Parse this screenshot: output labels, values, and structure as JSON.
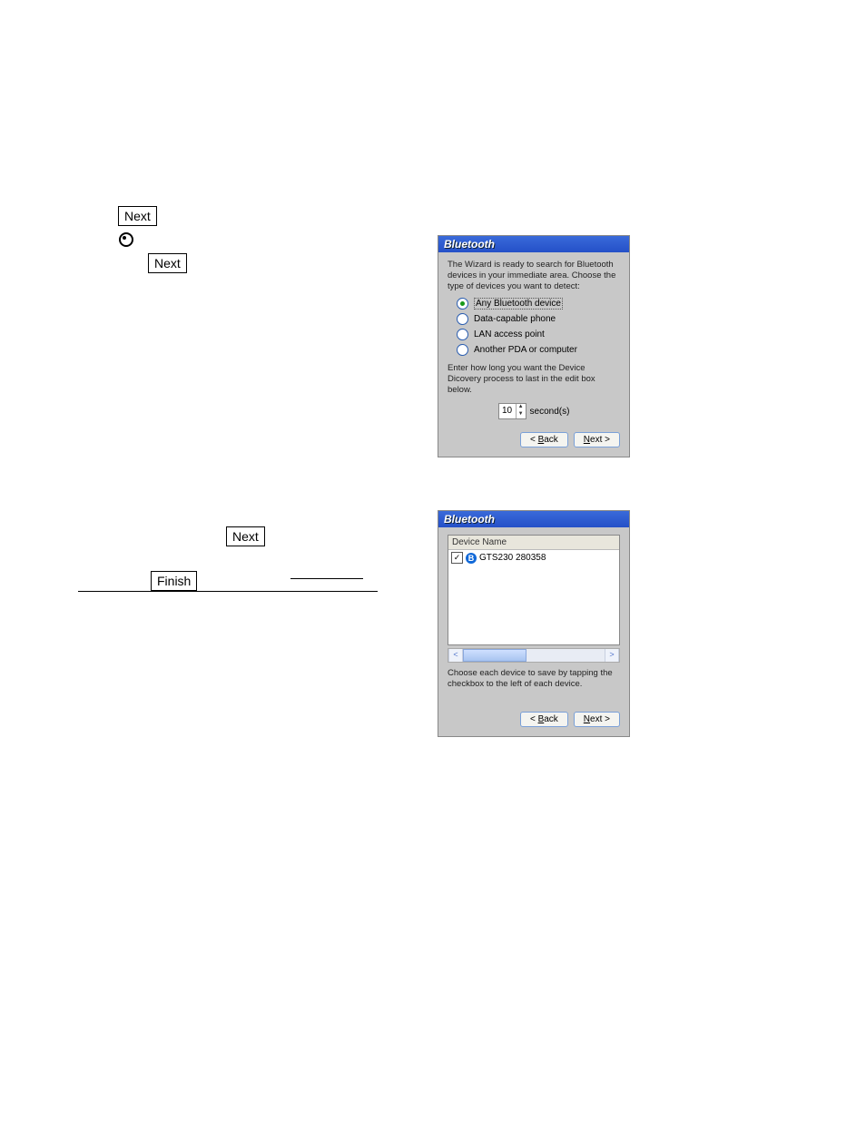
{
  "buttons": {
    "next": "Next",
    "finish": "Finish"
  },
  "panel1": {
    "title": "Bluetooth",
    "intro": "The Wizard is ready to search for Bluetooth devices in your immediate area. Choose the type of devices you want to detect:",
    "options": [
      {
        "label": "Any Bluetooth device",
        "selected": true
      },
      {
        "label": "Data-capable phone",
        "selected": false
      },
      {
        "label": "LAN access point",
        "selected": false
      },
      {
        "label": "Another PDA or computer",
        "selected": false
      }
    ],
    "duration_text": "Enter how long you want the Device Dicovery process to last in the edit box below.",
    "duration_value": "10",
    "duration_unit": "second(s)",
    "back": "< Back",
    "next_label_pre": "N",
    "next_label_post": "ext >"
  },
  "panel2": {
    "title": "Bluetooth",
    "header": "Device Name",
    "device": "GTS230 280358",
    "note": "Choose each device to save by tapping the checkbox to the left of each device.",
    "back": "< Back",
    "next_label_pre": "N",
    "next_label_post": "ext >"
  }
}
